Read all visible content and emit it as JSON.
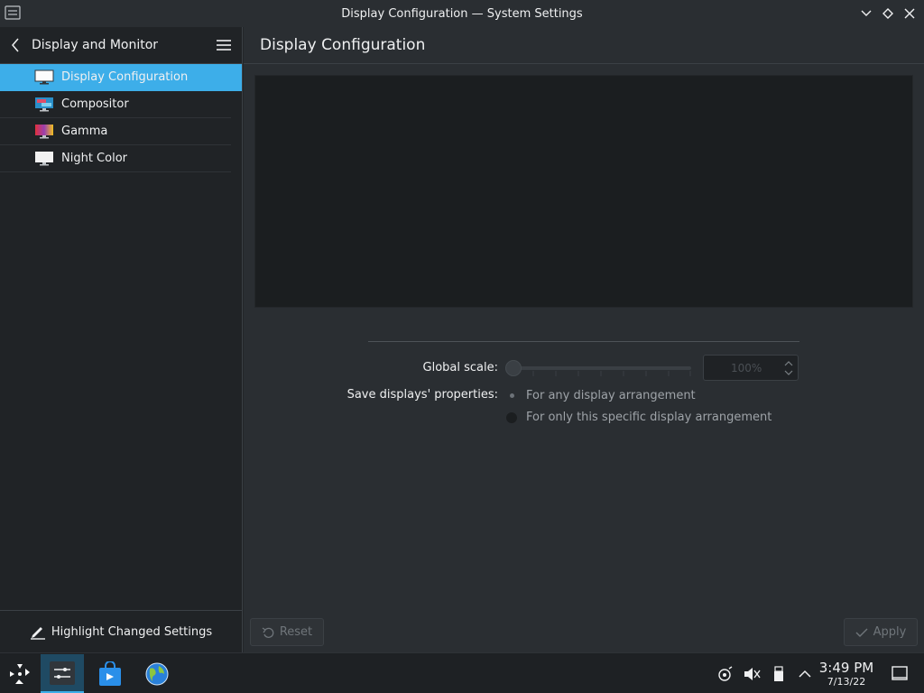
{
  "window": {
    "title": "Display Configuration — System Settings"
  },
  "sidebar": {
    "header_title": "Display and Monitor",
    "items": [
      {
        "label": "Display Configuration",
        "icon": "monitor-icon",
        "active": true
      },
      {
        "label": "Compositor",
        "icon": "compositor-icon",
        "active": false
      },
      {
        "label": "Gamma",
        "icon": "gamma-icon",
        "active": false
      },
      {
        "label": "Night Color",
        "icon": "night-color-icon",
        "active": false
      }
    ],
    "footer_label": "Highlight Changed Settings"
  },
  "main": {
    "page_title": "Display Configuration",
    "global_scale_label": "Global scale:",
    "global_scale_value": "100%",
    "global_scale_level": 0,
    "save_props_label": "Save displays' properties:",
    "radio_options": [
      {
        "label": "For any display arrangement",
        "checked": true
      },
      {
        "label": "For only this specific display arrangement",
        "checked": false
      }
    ],
    "reset_label": "Reset",
    "apply_label": "Apply"
  },
  "taskbar": {
    "time": "3:49 PM",
    "date": "7/13/22"
  },
  "colors": {
    "accent": "#3daee9",
    "background": "#2a2e32",
    "sidebar": "#202326"
  }
}
